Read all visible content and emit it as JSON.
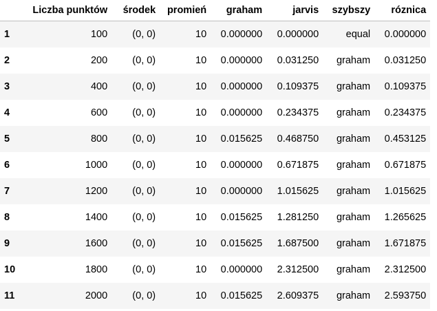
{
  "table": {
    "columns": [
      "Liczba punktów",
      "środek",
      "promień",
      "graham",
      "jarvis",
      "szybszy",
      "róznica"
    ],
    "rows": [
      {
        "index": "1",
        "cells": [
          "100",
          "(0, 0)",
          "10",
          "0.000000",
          "0.000000",
          "equal",
          "0.000000"
        ]
      },
      {
        "index": "2",
        "cells": [
          "200",
          "(0, 0)",
          "10",
          "0.000000",
          "0.031250",
          "graham",
          "0.031250"
        ]
      },
      {
        "index": "3",
        "cells": [
          "400",
          "(0, 0)",
          "10",
          "0.000000",
          "0.109375",
          "graham",
          "0.109375"
        ]
      },
      {
        "index": "4",
        "cells": [
          "600",
          "(0, 0)",
          "10",
          "0.000000",
          "0.234375",
          "graham",
          "0.234375"
        ]
      },
      {
        "index": "5",
        "cells": [
          "800",
          "(0, 0)",
          "10",
          "0.015625",
          "0.468750",
          "graham",
          "0.453125"
        ]
      },
      {
        "index": "6",
        "cells": [
          "1000",
          "(0, 0)",
          "10",
          "0.000000",
          "0.671875",
          "graham",
          "0.671875"
        ]
      },
      {
        "index": "7",
        "cells": [
          "1200",
          "(0, 0)",
          "10",
          "0.000000",
          "1.015625",
          "graham",
          "1.015625"
        ]
      },
      {
        "index": "8",
        "cells": [
          "1400",
          "(0, 0)",
          "10",
          "0.015625",
          "1.281250",
          "graham",
          "1.265625"
        ]
      },
      {
        "index": "9",
        "cells": [
          "1600",
          "(0, 0)",
          "10",
          "0.015625",
          "1.687500",
          "graham",
          "1.671875"
        ]
      },
      {
        "index": "10",
        "cells": [
          "1800",
          "(0, 0)",
          "10",
          "0.000000",
          "2.312500",
          "graham",
          "2.312500"
        ]
      },
      {
        "index": "11",
        "cells": [
          "2000",
          "(0, 0)",
          "10",
          "0.015625",
          "2.609375",
          "graham",
          "2.593750"
        ]
      }
    ]
  },
  "colors": {
    "stripe": "#f5f5f5",
    "background": "#ffffff",
    "header_border": "#bdbdbd",
    "text": "#000000"
  }
}
